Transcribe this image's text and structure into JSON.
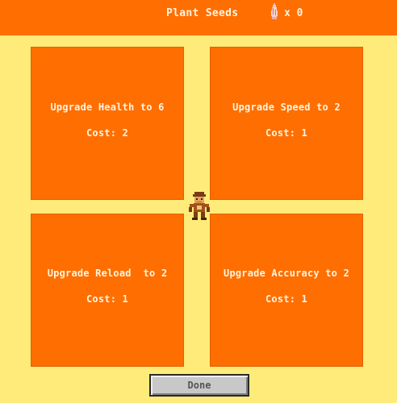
{
  "header": {
    "title": "Plant Seeds",
    "seed_icon": "seed-icon",
    "seed_count": "x 0"
  },
  "upgrades": [
    {
      "label": "Upgrade Health to 6",
      "cost": "Cost: 2"
    },
    {
      "label": "Upgrade Speed to 2",
      "cost": "Cost: 1"
    },
    {
      "label": "Upgrade Reload  to 2",
      "cost": "Cost: 1"
    },
    {
      "label": "Upgrade Accuracy to 2",
      "cost": "Cost: 1"
    }
  ],
  "player": {
    "icon": "player-character-icon"
  },
  "done_button": {
    "label": "Done"
  },
  "colors": {
    "background": "#FFEB7A",
    "panel": "#FF6E00",
    "text": "#FFF4E0",
    "button": "#C8C8C8"
  }
}
